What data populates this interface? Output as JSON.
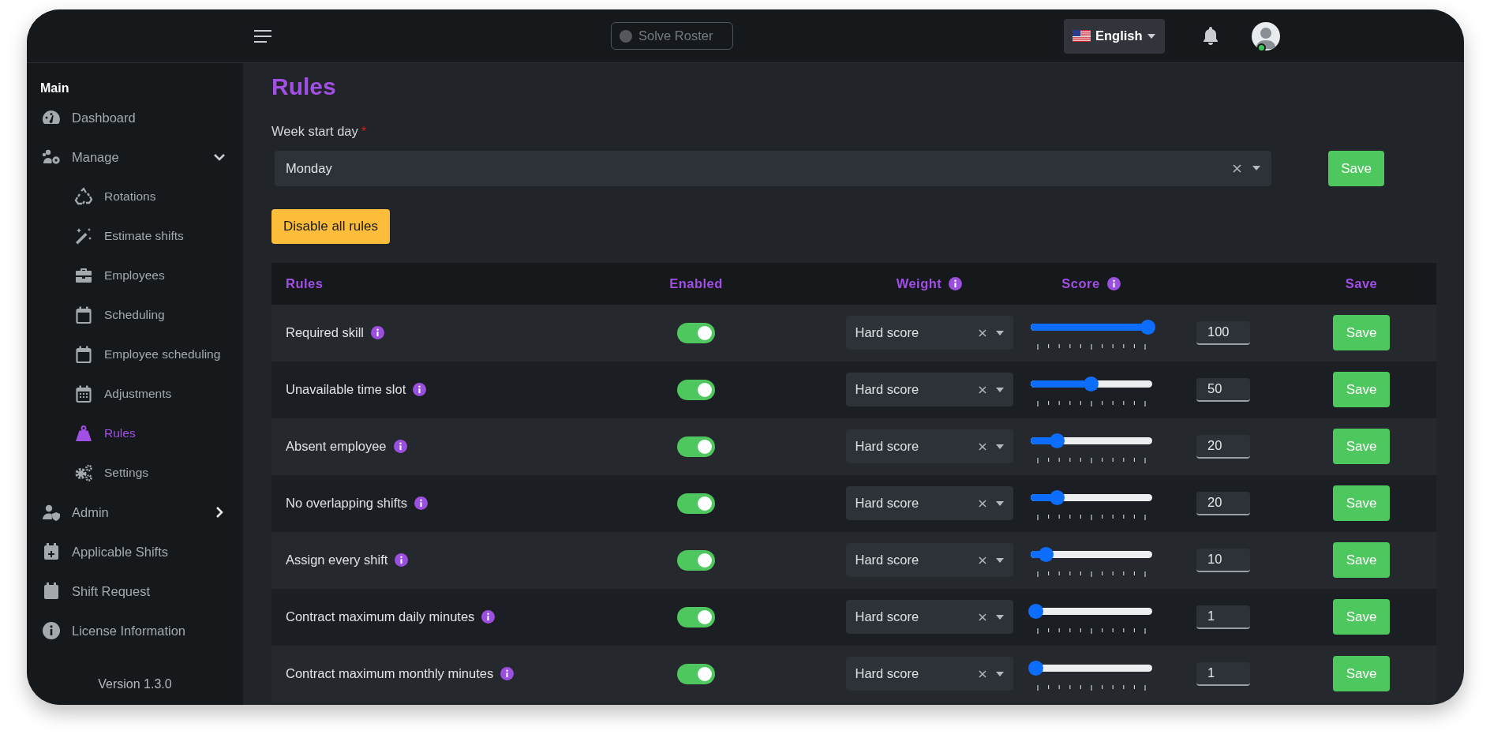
{
  "topbar": {
    "solve_button": {
      "label": "Solve Roster",
      "disabled": true
    },
    "language": {
      "label": "English"
    },
    "user": {
      "online": true
    }
  },
  "sidebar": {
    "section": "Main",
    "items": [
      {
        "label": "Dashboard",
        "selected": false
      },
      {
        "label": "Manage",
        "selected": false,
        "expanded": true,
        "children": [
          {
            "label": "Rotations",
            "selected": false
          },
          {
            "label": "Estimate shifts",
            "selected": false
          },
          {
            "label": "Employees",
            "selected": false
          },
          {
            "label": "Scheduling",
            "selected": false
          },
          {
            "label": "Employee scheduling",
            "selected": false
          },
          {
            "label": "Adjustments",
            "selected": false
          },
          {
            "label": "Rules",
            "selected": true
          },
          {
            "label": "Settings",
            "selected": false
          }
        ]
      },
      {
        "label": "Admin",
        "selected": false,
        "expanded": false
      },
      {
        "label": "Applicable Shifts",
        "selected": false
      },
      {
        "label": "Shift Request",
        "selected": false
      },
      {
        "label": "License Information",
        "selected": false
      }
    ],
    "version": "Version 1.3.0"
  },
  "page": {
    "title": "Rules",
    "week_start": {
      "label": "Week start day",
      "required_mark": "*",
      "value": "Monday",
      "save": "Save"
    },
    "disable_all": "Disable all rules"
  },
  "table": {
    "columns": [
      {
        "label": "Rules",
        "info": false
      },
      {
        "label": "Enabled",
        "info": false
      },
      {
        "label": "Weight",
        "info": true
      },
      {
        "label": "Score",
        "info": true
      },
      {
        "label": "Save",
        "info": false
      }
    ],
    "rows": [
      {
        "name": "Required skill",
        "info": true,
        "enabled": true,
        "weight": "Hard score",
        "level": 1,
        "score": "100",
        "save": "Save"
      },
      {
        "name": "Unavailable time slot",
        "info": true,
        "enabled": true,
        "weight": "Hard score",
        "level": 0.5,
        "score": "50",
        "save": "Save"
      },
      {
        "name": "Absent employee",
        "info": true,
        "enabled": true,
        "weight": "Hard score",
        "level": 0.2,
        "score": "20",
        "save": "Save"
      },
      {
        "name": "No overlapping shifts",
        "info": true,
        "enabled": true,
        "weight": "Hard score",
        "level": 0.2,
        "score": "20",
        "save": "Save"
      },
      {
        "name": "Assign every shift",
        "info": true,
        "enabled": true,
        "weight": "Hard score",
        "level": 0.1,
        "score": "10",
        "save": "Save"
      },
      {
        "name": "Contract maximum daily minutes",
        "info": true,
        "enabled": true,
        "weight": "Hard score",
        "level": 0.01,
        "score": "1",
        "save": "Save"
      },
      {
        "name": "Contract maximum monthly minutes",
        "info": true,
        "enabled": true,
        "weight": "Hard score",
        "level": 0.01,
        "score": "1",
        "save": "Save"
      }
    ]
  }
}
